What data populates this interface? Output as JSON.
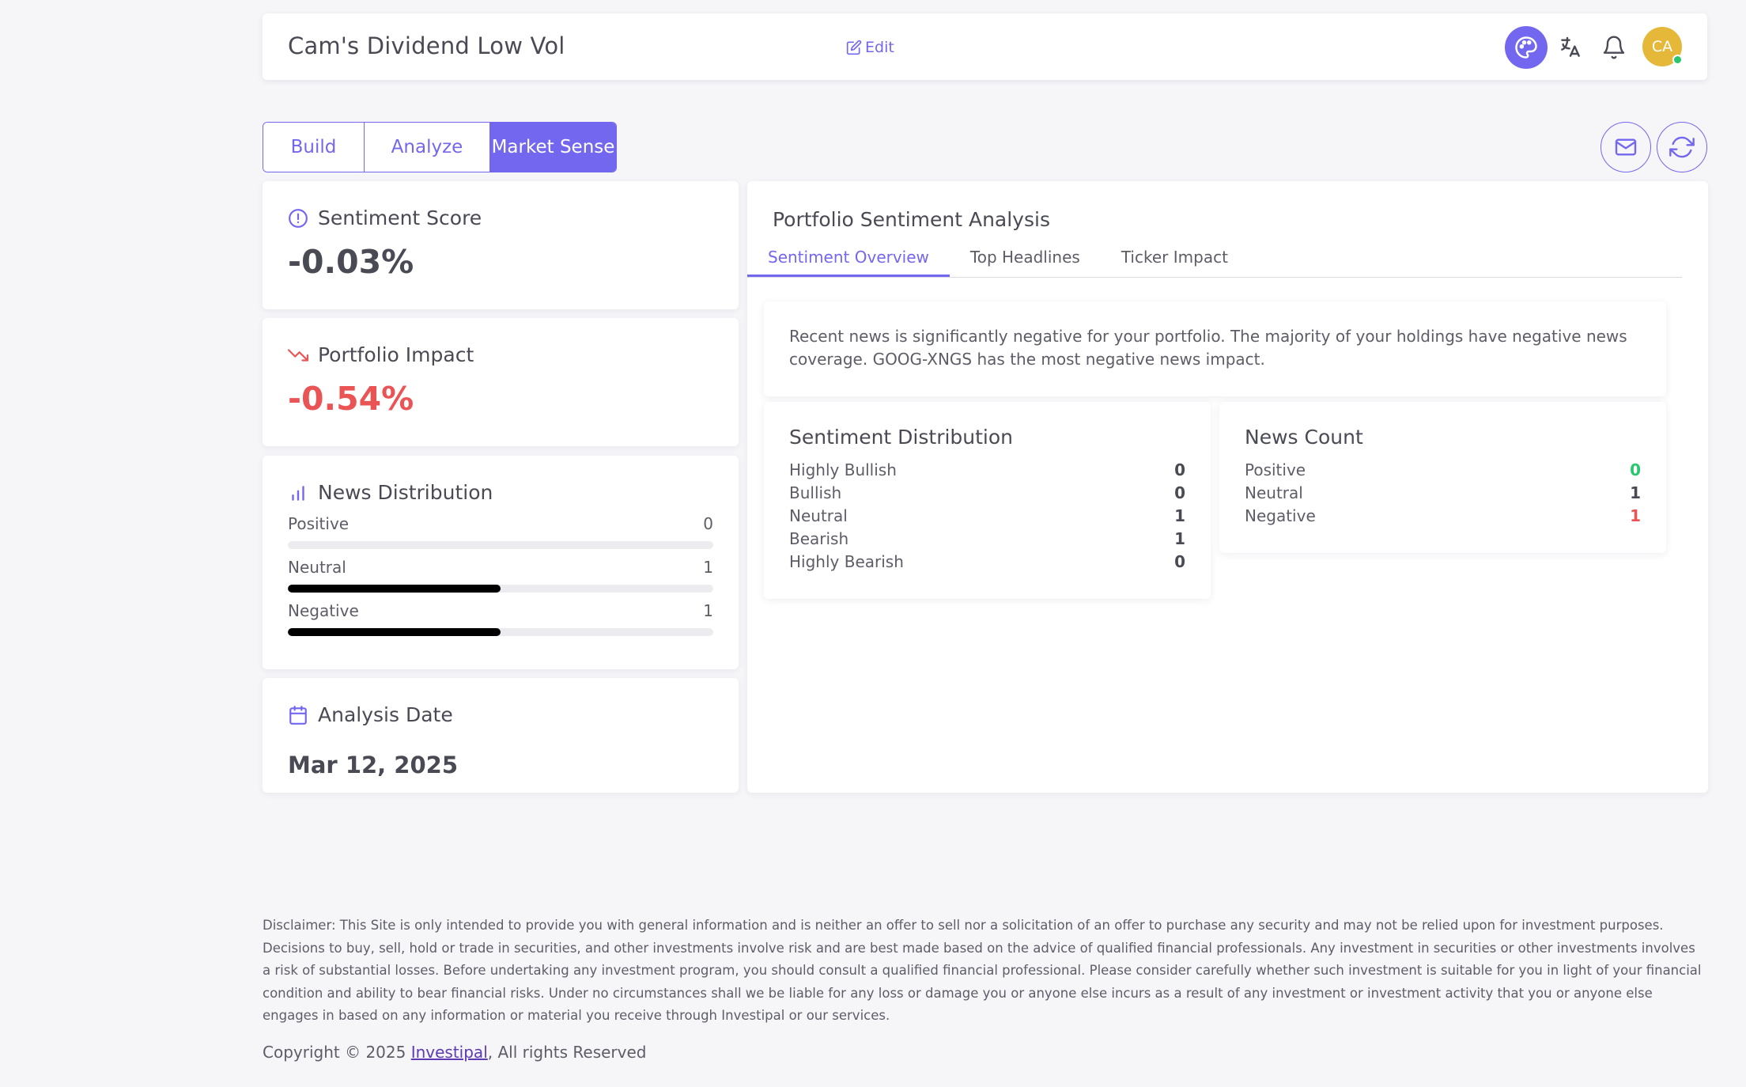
{
  "header": {
    "title": "Cam's Dividend Low Vol",
    "edit_label": "Edit",
    "avatar_initials": "CA"
  },
  "tabs": [
    {
      "label": "Build",
      "active": false
    },
    {
      "label": "Analyze",
      "active": false
    },
    {
      "label": "Market Sense",
      "active": true
    }
  ],
  "sentiment_score": {
    "title": "Sentiment Score",
    "value": "-0.03%"
  },
  "portfolio_impact": {
    "title": "Portfolio Impact",
    "value": "-0.54%"
  },
  "news_distribution": {
    "title": "News Distribution",
    "rows": [
      {
        "label": "Positive",
        "count": "0",
        "fraction": 0
      },
      {
        "label": "Neutral",
        "count": "1",
        "fraction": 0.5
      },
      {
        "label": "Negative",
        "count": "1",
        "fraction": 0.5
      }
    ]
  },
  "analysis_date": {
    "title": "Analysis Date",
    "value": "Mar 12, 2025"
  },
  "panel": {
    "title": "Portfolio Sentiment Analysis",
    "subtabs": [
      {
        "label": "Sentiment Overview",
        "active": true
      },
      {
        "label": "Top Headlines",
        "active": false
      },
      {
        "label": "Ticker Impact",
        "active": false
      }
    ],
    "summary": "Recent news is significantly negative for your portfolio. The majority of your holdings have negative news coverage. GOOG-XNGS has the most negative news impact.",
    "sentiment_distribution": {
      "title": "Sentiment Distribution",
      "rows": [
        {
          "label": "Highly Bullish",
          "value": "0"
        },
        {
          "label": "Bullish",
          "value": "0"
        },
        {
          "label": "Neutral",
          "value": "1"
        },
        {
          "label": "Bearish",
          "value": "1"
        },
        {
          "label": "Highly Bearish",
          "value": "0"
        }
      ]
    },
    "news_count": {
      "title": "News Count",
      "rows": [
        {
          "label": "Positive",
          "value": "0"
        },
        {
          "label": "Neutral",
          "value": "1"
        },
        {
          "label": "Negative",
          "value": "1"
        }
      ]
    }
  },
  "footer": {
    "disclaimer": "Disclaimer: This Site is only intended to provide you with general information and is neither an offer to sell nor a solicitation of an offer to purchase any security and may not be relied upon for investment purposes. Decisions to buy, sell, hold or trade in securities, and other investments involve risk and are best made based on the advice of qualified financial professionals. Any investment in securities or other investments involves a risk of substantial losses. Before undertaking any investment program, you should consult a qualified financial professional. Please consider carefully whether such investment is suitable for you in light of your financial condition and ability to bear financial risks. Under no circumstances shall we be liable for any loss or damage you or anyone else incurs as a result of any investment or investment activity that you or anyone else engages in based on any information or material you receive through Investipal or our services.",
    "copyright_prefix": "Copyright © 2025 ",
    "copyright_link": "Investipal",
    "copyright_suffix": ", All rights Reserved"
  },
  "colors": {
    "accent": "#7367f0",
    "negative": "#ea5455",
    "positive": "#28c76f",
    "avatar": "#e6b83a"
  },
  "icons": [
    "edit-icon",
    "palette-icon",
    "translate-icon",
    "bell-icon",
    "mail-icon",
    "refresh-icon",
    "alert-circle-icon",
    "trending-down-icon",
    "bar-chart-icon",
    "calendar-icon"
  ]
}
